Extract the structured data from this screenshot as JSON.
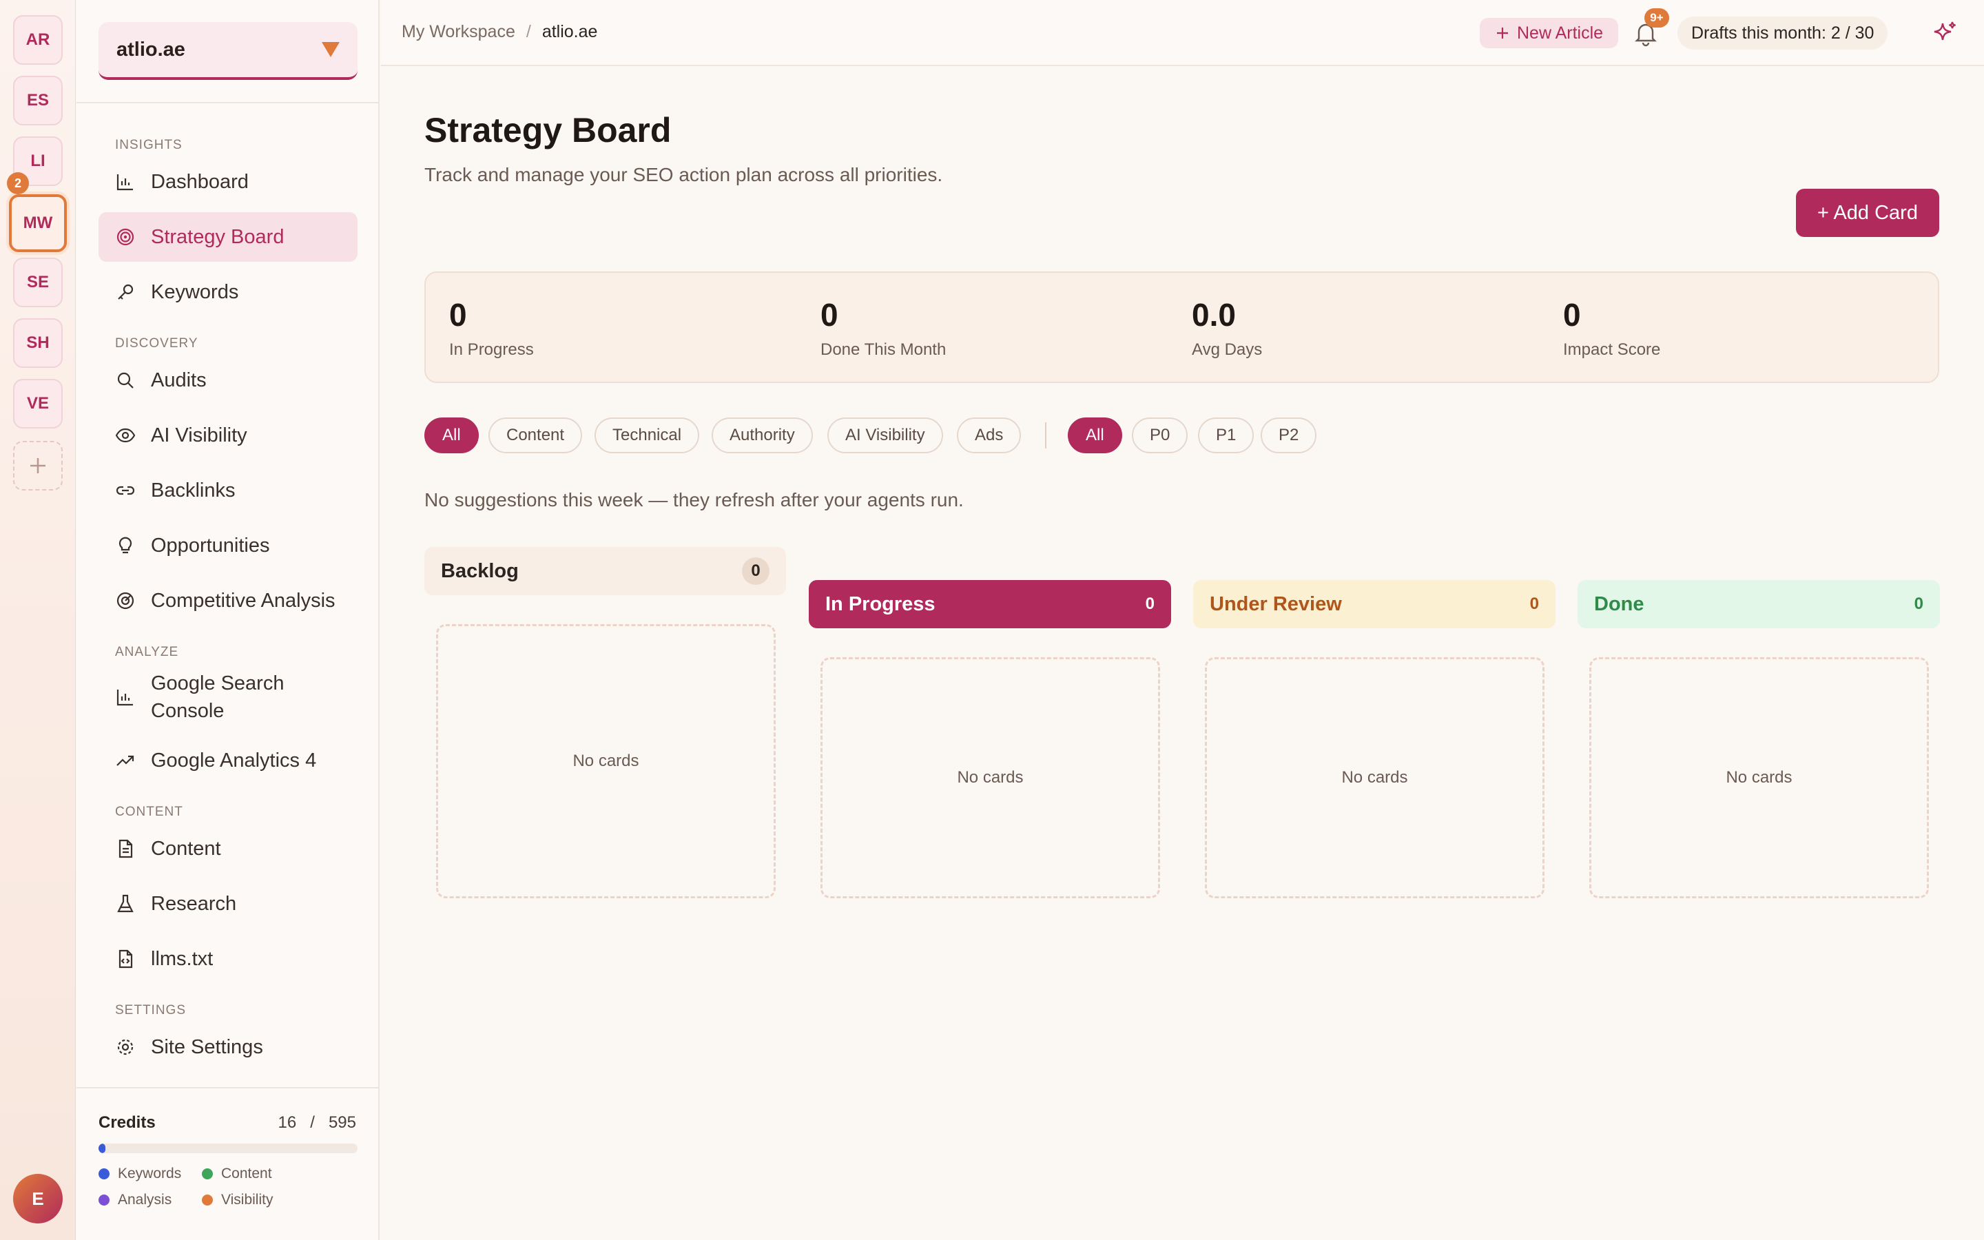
{
  "workspaces": {
    "items": [
      {
        "label": "AR"
      },
      {
        "label": "ES"
      },
      {
        "label": "LI"
      },
      {
        "label": "MW"
      },
      {
        "label": "SE"
      },
      {
        "label": "SH"
      },
      {
        "label": "VE"
      }
    ],
    "active_badge": "2",
    "add_icon": "plus-icon",
    "user_initial": "E"
  },
  "sidebar": {
    "site": "atlio.ae",
    "sections": {
      "insights": "INSIGHTS",
      "discovery": "DISCOVERY",
      "analyze": "ANALYZE",
      "content": "CONTENT",
      "settings": "SETTINGS"
    },
    "items": {
      "dashboard": "Dashboard",
      "strategy_board": "Strategy Board",
      "keywords": "Keywords",
      "audits": "Audits",
      "ai_visibility": "AI Visibility",
      "backlinks": "Backlinks",
      "opportunities": "Opportunities",
      "competitive": "Competitive Analysis",
      "gsc": "Google Search Console",
      "ga4": "Google Analytics 4",
      "content": "Content",
      "research": "Research",
      "llms": "llms.txt",
      "site_settings": "Site Settings"
    },
    "credits": {
      "label": "Credits",
      "used": "16",
      "sep": "/",
      "total": "595",
      "fraction_used": 0.027,
      "legend": {
        "keywords": "Keywords",
        "content": "Content",
        "analysis": "Analysis",
        "visibility": "Visibility"
      },
      "colors": {
        "keywords": "#3a5bd9",
        "content": "#3ea55a",
        "analysis": "#7b4fd6",
        "visibility": "#e07a3a"
      }
    }
  },
  "topbar": {
    "breadcrumb_root": "My Workspace",
    "breadcrumb_sep": "/",
    "breadcrumb_current": "atlio.ae",
    "new_article": "New Article",
    "notif_badge": "9+",
    "drafts": "Drafts this month: 2 / 30"
  },
  "main": {
    "title": "Strategy Board",
    "subtitle": "Track and manage your SEO action plan across all priorities.",
    "add_card": "+ Add Card",
    "stats": {
      "in_progress": {
        "value": "0",
        "label": "In Progress"
      },
      "done_month": {
        "value": "0",
        "label": "Done This Month"
      },
      "avg_days": {
        "value": "0.0",
        "label": "Avg Days"
      },
      "impact": {
        "value": "0",
        "label": "Impact Score"
      }
    },
    "category_filters": [
      "All",
      "Content",
      "Technical",
      "Authority",
      "AI Visibility",
      "Ads"
    ],
    "priority_filters": [
      "All",
      "P0",
      "P1",
      "P2"
    ],
    "notice": "No suggestions this week — they refresh after your agents run.",
    "columns": {
      "backlog": {
        "title": "Backlog",
        "count": "0",
        "empty": "No cards"
      },
      "in_progress": {
        "title": "In Progress",
        "count": "0",
        "empty": "No cards"
      },
      "under_review": {
        "title": "Under Review",
        "count": "0",
        "empty": "No cards"
      },
      "done": {
        "title": "Done",
        "count": "0",
        "empty": "No cards"
      }
    }
  },
  "colors": {
    "accent": "#b02a5b",
    "orange": "#e07a3a"
  }
}
